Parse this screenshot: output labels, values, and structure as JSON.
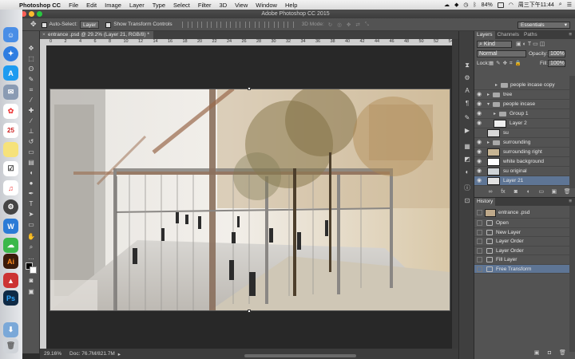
{
  "menubar": {
    "app_name": "Photoshop CC",
    "items": [
      "File",
      "Edit",
      "Image",
      "Layer",
      "Type",
      "Select",
      "Filter",
      "3D",
      "View",
      "Window",
      "Help"
    ],
    "battery": "84%",
    "clock": "周三下午11:44"
  },
  "window": {
    "title": "Adobe Photoshop CC 2015"
  },
  "options_bar": {
    "auto_select_label": "Auto-Select:",
    "auto_select_value": "Layer",
    "show_transform_label": "Show Transform Controls",
    "mode_3d_label": "3D Mode:"
  },
  "workspace": {
    "value": "Essentials"
  },
  "document": {
    "tab_title": "entrance .psd @ 29.2% (Layer 21, RGB/8) *",
    "zoom": "29.16%",
    "doc_size": "Doc: 76.7M/821.7M",
    "ruler_ticks": [
      "0",
      "2",
      "4",
      "6",
      "8",
      "10",
      "12",
      "14",
      "16",
      "18",
      "20",
      "22",
      "24",
      "26",
      "28",
      "30",
      "32",
      "34",
      "36",
      "38",
      "40",
      "42",
      "44",
      "46",
      "48",
      "50",
      "52",
      "54"
    ]
  },
  "layers_panel": {
    "tabs": [
      "Layers",
      "Channels",
      "Paths"
    ],
    "filter_value": "Kind",
    "blend_mode": "Normal",
    "opacity_label": "Opacity:",
    "opacity_value": "100%",
    "lock_label": "Lock:",
    "fill_label": "Fill:",
    "fill_value": "100%",
    "layers": [
      {
        "name": "people incase copy",
        "type": "group"
      },
      {
        "name": "tree",
        "type": "group"
      },
      {
        "name": "people incase",
        "type": "group"
      },
      {
        "name": "Group 1",
        "type": "group"
      },
      {
        "name": "Layer 2",
        "type": "layer"
      },
      {
        "name": "su",
        "type": "layer"
      },
      {
        "name": "surrounding",
        "type": "group"
      },
      {
        "name": "surrounding right",
        "type": "layer"
      },
      {
        "name": "white background",
        "type": "layer"
      },
      {
        "name": "su original",
        "type": "layer"
      },
      {
        "name": "Layer 21",
        "type": "layer",
        "selected": true
      }
    ]
  },
  "history_panel": {
    "title": "History",
    "snapshot": "entrance .psd",
    "states": [
      "Open",
      "New Layer",
      "Layer Order",
      "Layer Order",
      "Fill Layer",
      "Free Transform"
    ],
    "selected_state": "Free Transform"
  },
  "colors": {
    "panel_bg": "#535353",
    "selection": "#5e7595",
    "pasteboard": "#282828"
  }
}
